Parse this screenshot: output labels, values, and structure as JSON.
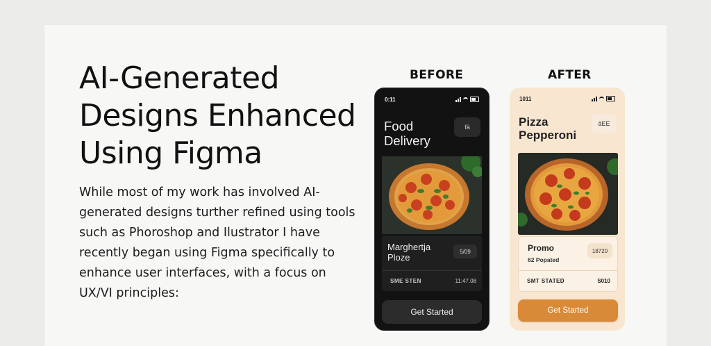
{
  "headline": [
    "AI-Generated",
    "Designs Enhanced",
    "Using Figma"
  ],
  "body": [
    "While most of my work has involved AI-",
    "generated designs turther refined using tools",
    "such as Phoroshop and Ilustrator  I have",
    "recently began using Figma specifically to",
    "enhance user interfaces, with a focus on",
    "UX/VI principles:"
  ],
  "labels": {
    "before": "BEFORE",
    "after": "AFTER"
  },
  "before_phone": {
    "time": "0:11",
    "title_line1": "Food",
    "title_line2": "Delivery",
    "icon_btn": "fä",
    "item_name_line1": "Marghertja",
    "item_name_line2": "Ploze",
    "price": "5/09",
    "row_left": "SME STEN",
    "row_right": "11:47.08",
    "cta": "Get Started"
  },
  "after_phone": {
    "time": "1011",
    "title_line1": "Pizza",
    "title_line2": "Pepperoni",
    "icon_btn": "äEE",
    "item_name": "Promo",
    "item_sub": "62 Popated",
    "price": "18720",
    "row_left": "SMT STATED",
    "row_right": "S010",
    "cta": "Get Started"
  },
  "colors": {
    "accent": "#d98a38",
    "dark_bg": "#121212",
    "light_bg": "#f8e6d0"
  }
}
